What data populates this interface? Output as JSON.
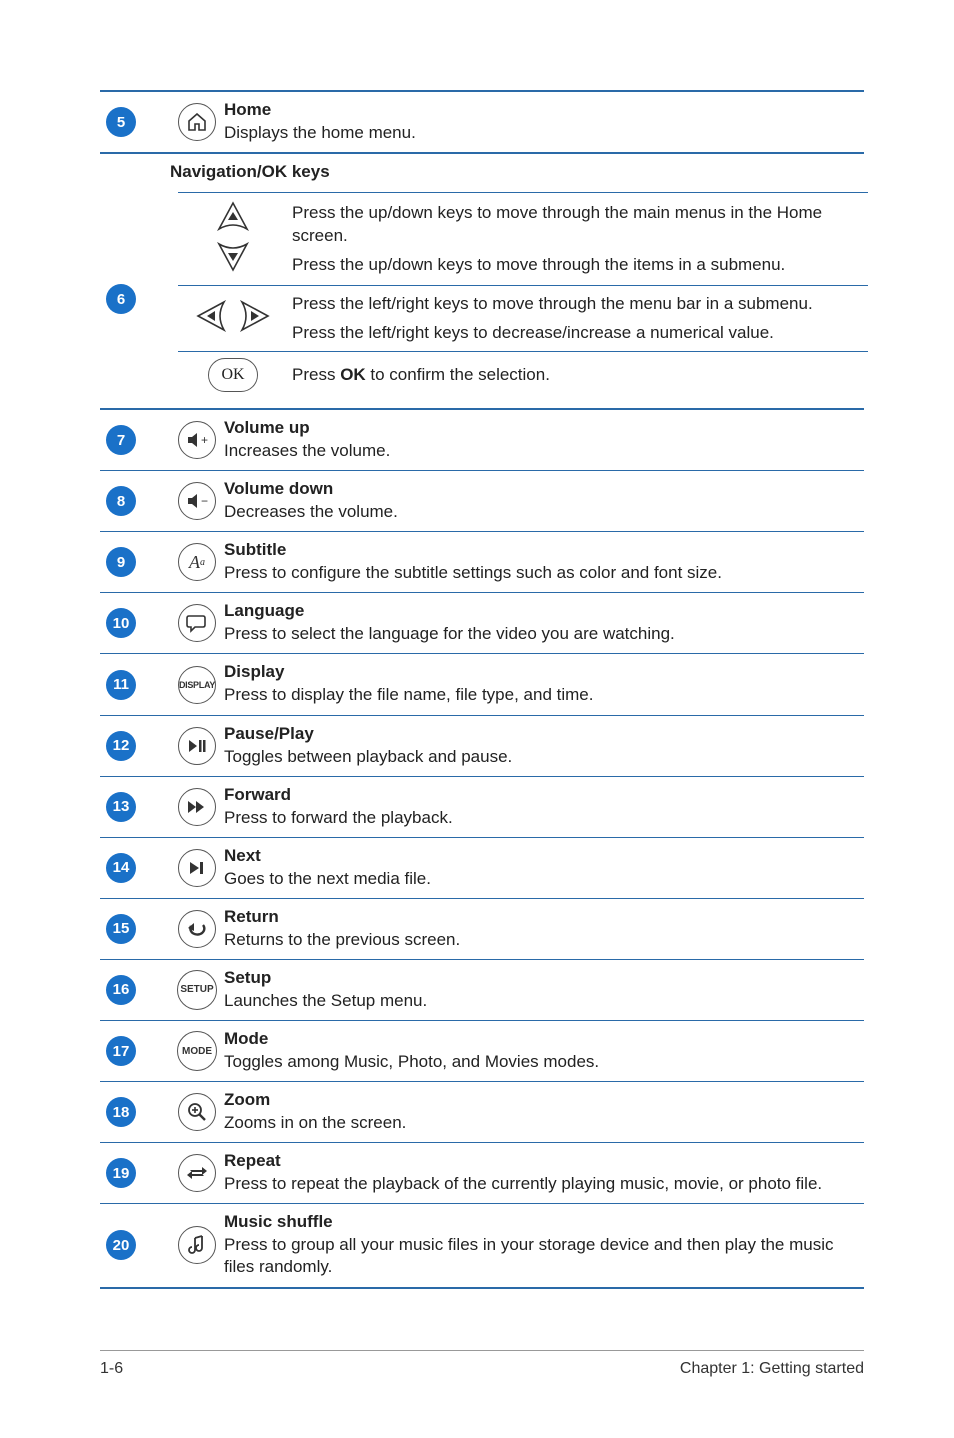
{
  "rows": {
    "r5": {
      "num": "5",
      "title": "Home",
      "desc": "Displays the home menu."
    },
    "r6": {
      "num": "6",
      "section": "Navigation/OK keys",
      "up_d1": "Press the up/down keys to move through the main menus in the Home screen.",
      "up_d2": "Press the up/down keys to move through the items in a submenu.",
      "lr_d1": "Press the left/right keys to move through the menu bar in a submenu.",
      "lr_d2": "Press the left/right keys to decrease/increase a numerical value.",
      "ok_pre": "Press ",
      "ok_bold": "OK",
      "ok_post": " to confirm the selection.",
      "ok_label": "OK"
    },
    "r7": {
      "num": "7",
      "title": "Volume up",
      "desc": "Increases the volume."
    },
    "r8": {
      "num": "8",
      "title": "Volume down",
      "desc": "Decreases the volume."
    },
    "r9": {
      "num": "9",
      "title": "Subtitle",
      "desc": "Press to configure the subtitle settings such as color and font size."
    },
    "r10": {
      "num": "10",
      "title": "Language",
      "desc": "Press to select the language for the video you are watching."
    },
    "r11": {
      "num": "11",
      "title": "Display",
      "desc": "Press to display the file name, file type, and time.",
      "icon": "DISPLAY"
    },
    "r12": {
      "num": "12",
      "title": "Pause/Play",
      "desc": "Toggles between playback and pause."
    },
    "r13": {
      "num": "13",
      "title": "Forward",
      "desc": "Press to forward the playback."
    },
    "r14": {
      "num": "14",
      "title": "Next",
      "desc": "Goes to the next media file."
    },
    "r15": {
      "num": "15",
      "title": "Return",
      "desc": "Returns to the previous screen."
    },
    "r16": {
      "num": "16",
      "title": "Setup",
      "desc": "Launches the Setup menu.",
      "icon": "SETUP"
    },
    "r17": {
      "num": "17",
      "title": "Mode",
      "desc": "Toggles among Music, Photo, and Movies modes.",
      "icon": "MODE"
    },
    "r18": {
      "num": "18",
      "title": "Zoom",
      "desc": "Zooms in on the screen."
    },
    "r19": {
      "num": "19",
      "title": "Repeat",
      "desc": "Press to repeat the playback of the currently playing music, movie, or photo file."
    },
    "r20": {
      "num": "20",
      "title": "Music shuffle",
      "desc": "Press to group all your music files in your storage device and then play the music files randomly."
    }
  },
  "footer": {
    "page": "1-6",
    "chapter": "Chapter 1:  Getting started"
  }
}
